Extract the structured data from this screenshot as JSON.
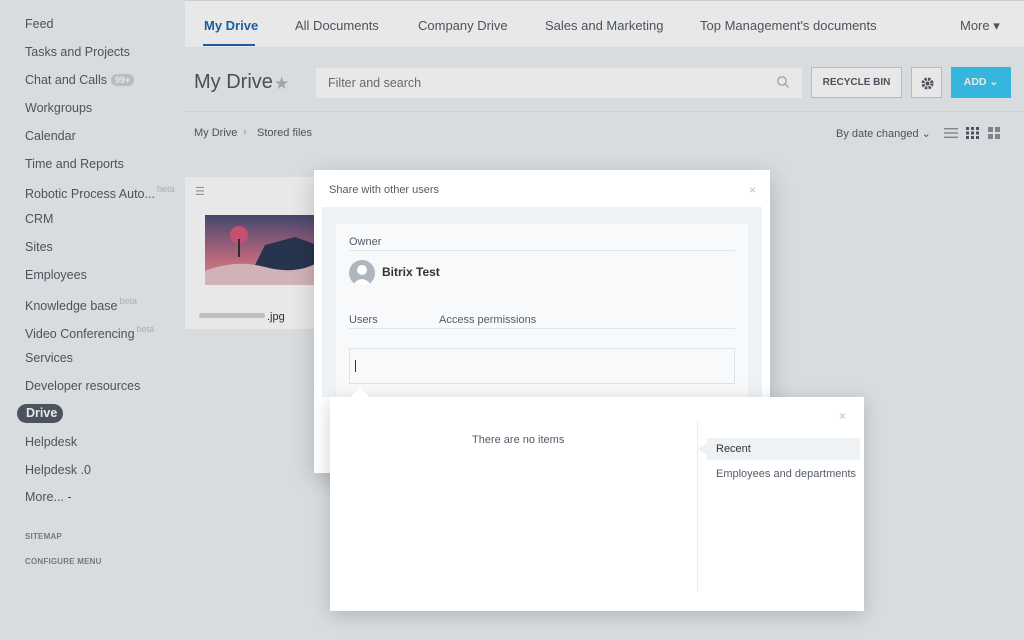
{
  "sidebar": {
    "items": [
      {
        "label": "Feed"
      },
      {
        "label": "Tasks and Projects"
      },
      {
        "label": "Chat and Calls",
        "counter": "99+"
      },
      {
        "label": "Workgroups"
      },
      {
        "label": "Calendar"
      },
      {
        "label": "Time and Reports"
      },
      {
        "label": "Robotic Process Auto...",
        "beta": "beta"
      },
      {
        "label": "CRM"
      },
      {
        "label": "Sites"
      },
      {
        "label": "Employees"
      },
      {
        "label": "Knowledge base",
        "beta": "beta"
      },
      {
        "label": "Video Conferencing",
        "beta": "beta"
      },
      {
        "label": "Services"
      },
      {
        "label": "Developer resources"
      },
      {
        "label": "Drive"
      },
      {
        "label": "Helpdesk"
      },
      {
        "label": "Helpdesk .0"
      },
      {
        "label": "More... -"
      }
    ],
    "sitemap": "SITEMAP",
    "configure_menu": "CONFIGURE MENU"
  },
  "tabs": [
    "My Drive",
    "All Documents",
    "Company Drive",
    "Sales and Marketing",
    "Top Management's documents",
    "More ▾"
  ],
  "header": {
    "title": "My Drive",
    "search_placeholder": "Filter and search",
    "recycle_bin": "RECYCLE BIN",
    "add": "ADD"
  },
  "breadcrumb": {
    "root": "My Drive",
    "sep": "›",
    "current": "Stored files"
  },
  "sort_label": "By date changed",
  "file": {
    "name_suffix": ".jpg"
  },
  "share_dialog": {
    "title": "Share with other users",
    "close": "×",
    "owner_label": "Owner",
    "owner_name": "Bitrix Test",
    "users_label": "Users",
    "access_label": "Access permissions",
    "input_value": ""
  },
  "selector": {
    "close": "×",
    "empty_text": "There are no items",
    "tab_recent": "Recent",
    "tab_employees": "Employees and departments"
  },
  "colors": {
    "accent": "#2067b0",
    "add_button": "#3bc8f5",
    "sidebar_active": "#535c69"
  }
}
